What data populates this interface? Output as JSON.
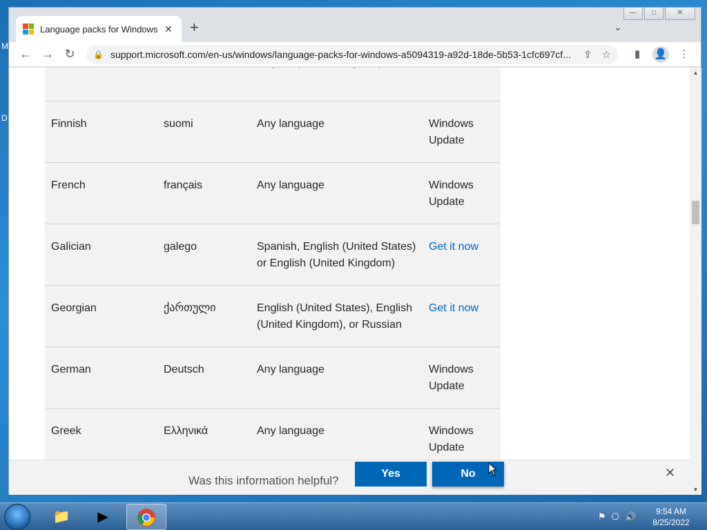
{
  "desktop": {
    "edge_letters": [
      "M",
      "D"
    ]
  },
  "browser": {
    "tab": {
      "title": "Language packs for Windows",
      "close": "✕"
    },
    "new_tab": "+",
    "tab_menu": "⌄",
    "window_controls": {
      "minimize": "—",
      "maximize": "□",
      "close": "✕"
    },
    "toolbar": {
      "back": "←",
      "forward": "→",
      "reload": "↻"
    },
    "url": "support.microsoft.com/en-us/windows/language-packs-for-windows-a5094319-a92d-18de-5b53-1cfc697cf..."
  },
  "table": {
    "rows": [
      {
        "language": "",
        "native": "",
        "base": "English (United Kingdom)",
        "action": "",
        "action_is_link": false
      },
      {
        "language": "Finnish",
        "native": "suomi",
        "base": "Any language",
        "action": "Windows Update",
        "action_is_link": false
      },
      {
        "language": "French",
        "native": "français",
        "base": "Any language",
        "action": "Windows Update",
        "action_is_link": false
      },
      {
        "language": "Galician",
        "native": "galego",
        "base": "Spanish, English (United States) or English (United Kingdom)",
        "action": "Get it now",
        "action_is_link": true
      },
      {
        "language": "Georgian",
        "native": "ქართული",
        "base": "English (United States), English (United Kingdom), or Russian",
        "action": "Get it now",
        "action_is_link": true
      },
      {
        "language": "German",
        "native": "Deutsch",
        "base": "Any language",
        "action": "Windows Update",
        "action_is_link": false
      },
      {
        "language": "Greek",
        "native": "Ελληνικά",
        "base": "Any language",
        "action": "Windows Update",
        "action_is_link": false
      }
    ]
  },
  "feedback": {
    "question": "Was this information helpful?",
    "yes": "Yes",
    "no": "No",
    "close": "✕"
  },
  "taskbar": {
    "clock_time": "9:54 AM",
    "clock_date": "8/25/2022"
  },
  "colors": {
    "link": "#0067b8",
    "button": "#0067b8",
    "taskbar": "#2c5f93"
  }
}
